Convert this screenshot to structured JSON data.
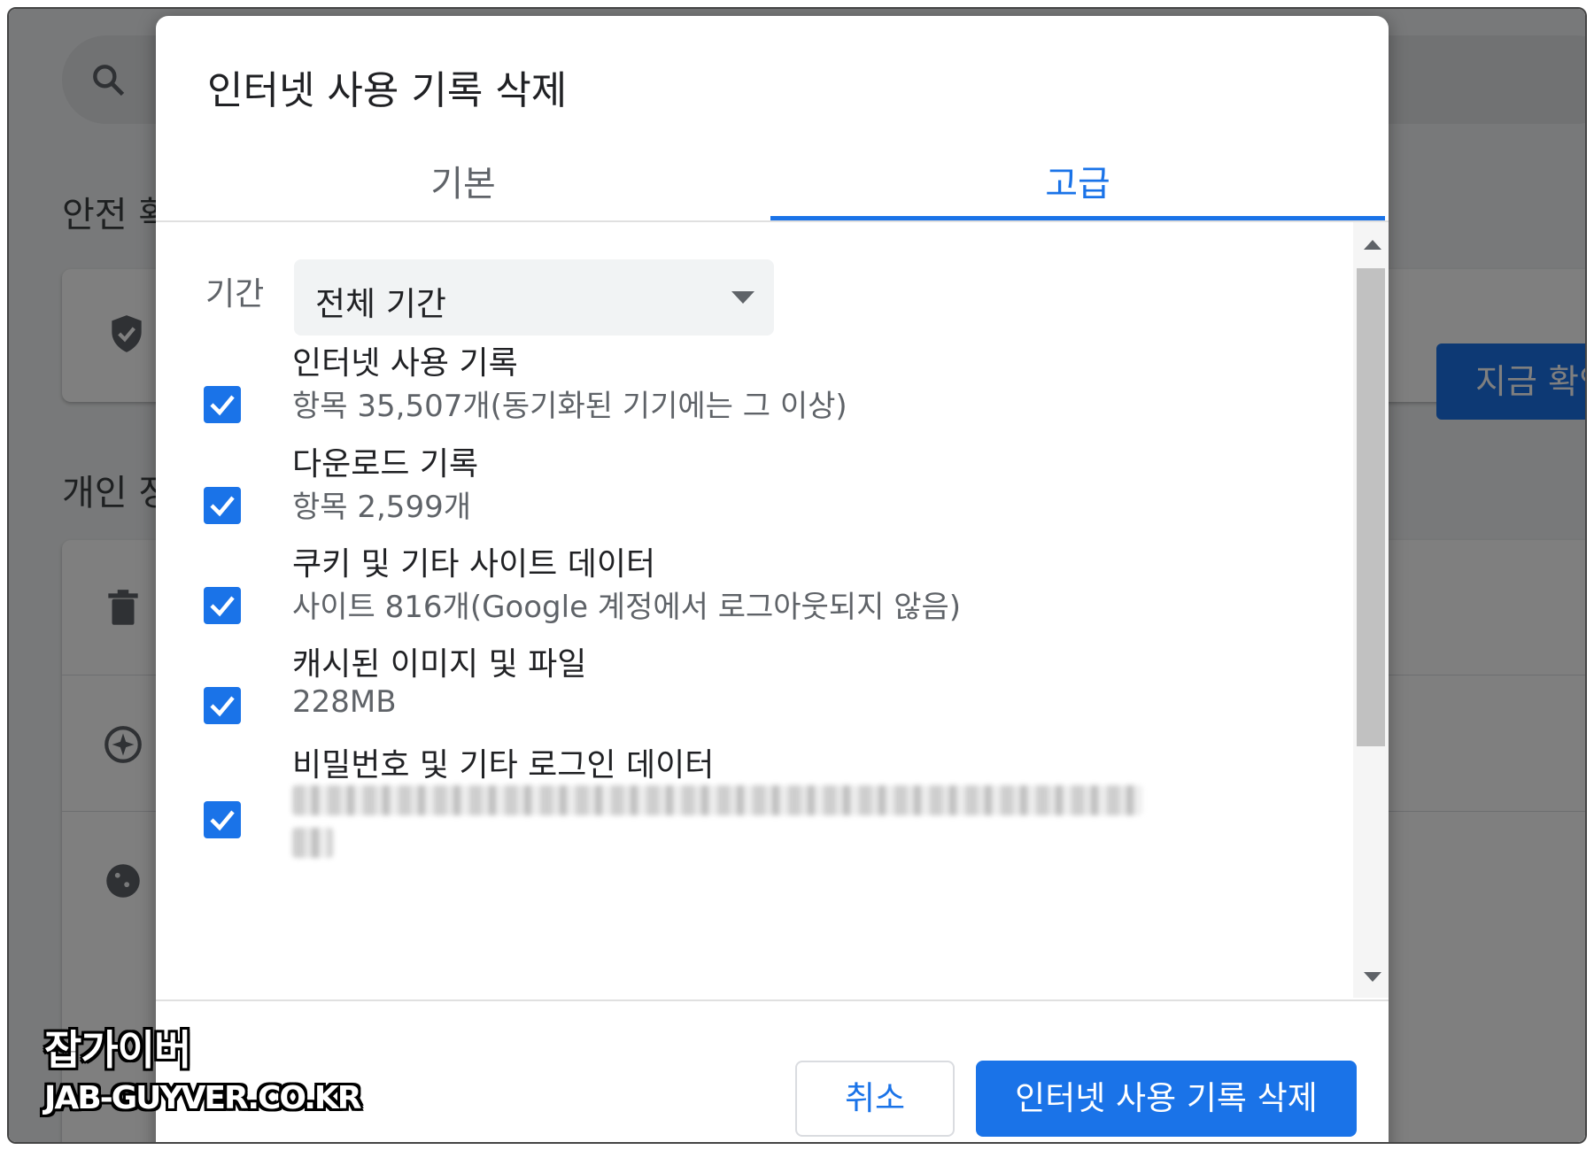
{
  "background": {
    "section_security": "안전 확",
    "section_privacy": "개인 정",
    "check_now_button": "지금 확인"
  },
  "dialog": {
    "title": "인터넷 사용 기록 삭제",
    "tabs": [
      {
        "label": "기본",
        "selected": false
      },
      {
        "label": "고급",
        "selected": true
      }
    ],
    "period": {
      "label": "기간",
      "value": "전체 기간"
    },
    "items": [
      {
        "title": "인터넷 사용 기록",
        "subtitle": "항목 35,507개(동기화된 기기에는 그 이상)",
        "checked": true
      },
      {
        "title": "다운로드 기록",
        "subtitle": "항목 2,599개",
        "checked": true
      },
      {
        "title": "쿠키 및 기타 사이트 데이터",
        "subtitle": "사이트 816개(Google 계정에서 로그아웃되지 않음)",
        "checked": true
      },
      {
        "title": "캐시된 이미지 및 파일",
        "subtitle": "228MB",
        "checked": true
      },
      {
        "title": "비밀번호 및 기타 로그인 데이터",
        "subtitle": "",
        "checked": true
      }
    ],
    "cancel_label": "취소",
    "delete_label": "인터넷 사용 기록 삭제"
  },
  "watermark": {
    "line1": "잡가이버",
    "line2": "JAB-GUYVER.CO.KR"
  },
  "colors": {
    "accent": "#1a73e8",
    "text_primary": "#202124",
    "text_secondary": "#5f6368"
  }
}
